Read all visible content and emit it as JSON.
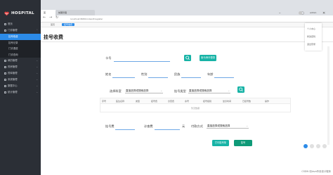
{
  "browser": {
    "tabs": [
      "首",
      "前期管理"
    ],
    "url": "localhost:8080/index#/register",
    "breadcrumb": [
      "首页",
      "挂号收费"
    ]
  },
  "sidebar": {
    "logo_text": "HOSPITAL",
    "items": [
      {
        "label": "首页",
        "type": "top"
      },
      {
        "label": "门诊管理",
        "type": "top",
        "expanded": true
      },
      {
        "label": "挂号收费",
        "type": "sub",
        "active": true
      },
      {
        "label": "挂号记录",
        "type": "sub"
      },
      {
        "label": "门诊退费",
        "type": "sub"
      },
      {
        "label": "门诊查询",
        "type": "sub"
      },
      {
        "label": "病历管理",
        "type": "top"
      },
      {
        "label": "药房管理",
        "type": "top"
      },
      {
        "label": "药库管理",
        "type": "top"
      },
      {
        "label": "系统管理",
        "type": "top"
      },
      {
        "label": "数据中心",
        "type": "top"
      },
      {
        "label": "统计管理",
        "type": "top"
      }
    ]
  },
  "user": {
    "name": "admin",
    "menu": [
      "个人中心",
      "修改密码",
      "退出登录"
    ]
  },
  "page": {
    "title": "挂号收费",
    "card_label": "卡号",
    "card_button": "读卡/刷卡登录",
    "name_label": "姓名",
    "gender_label": "性别",
    "ethnicity_label": "民族",
    "age_label": "年龄",
    "dept_label": "选择科室",
    "dept_placeholder": "直接选择或搜索选择",
    "reg_type_label": "挂号类型",
    "reg_type_placeholder": "直接选择或搜索选择",
    "table_headers": [
      "序号",
      "医生名称",
      "类型",
      "挂号费",
      "诊查费",
      "余号",
      "挂号级别",
      "坐诊时间",
      "已挂号数",
      "操作"
    ],
    "empty_text": "暂无数据",
    "fee_label": "挂号费",
    "consult_label": "诊查费",
    "currency": "元",
    "payment_label": "付款方式",
    "payment_placeholder": "直接选择或搜索选择",
    "print_button": "打印挂号单",
    "confirm_button": "挂号"
  },
  "footer": {
    "watermark": "CSDN @Java毕设设计程序"
  },
  "colors": {
    "sidebar": "#2b2f36",
    "accent": "#2c8be8",
    "teal": "#17b3a6",
    "confirm": "#0f9a78"
  }
}
